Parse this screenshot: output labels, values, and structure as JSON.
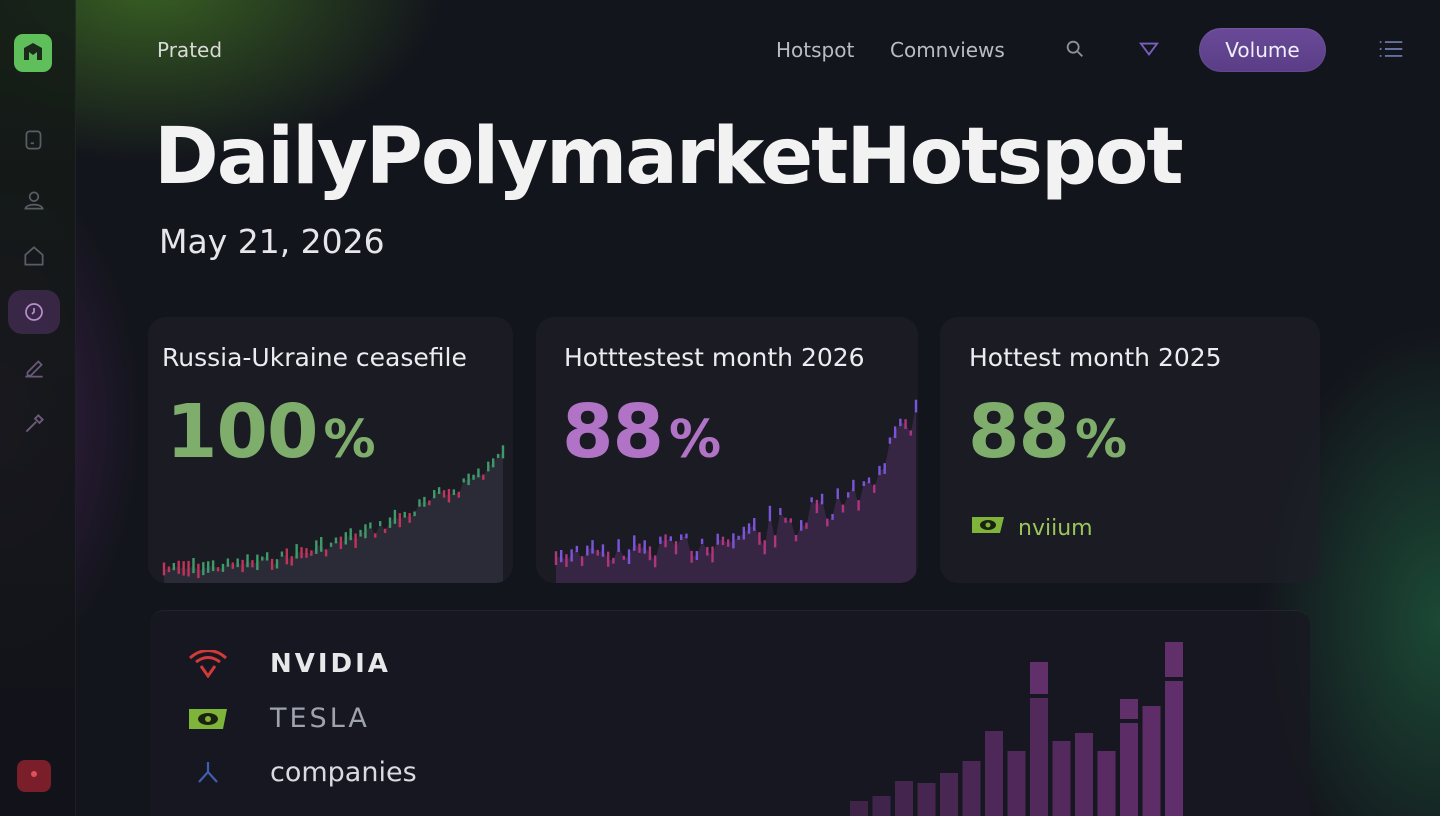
{
  "header": {
    "brand": "Prated",
    "nav": [
      "Hotspot",
      "Comnviews"
    ],
    "volume_label": "Volume"
  },
  "page": {
    "title": "DailyPolymarketHotspot",
    "date": "May 21, 2026"
  },
  "cards": [
    {
      "title": "Russia-Ukraine ceasefile",
      "value": "100",
      "unit": "%",
      "color": "#7fae6c"
    },
    {
      "title": "Hotttestest month 2026",
      "value": "88",
      "unit": "%",
      "color": "#b073c6"
    },
    {
      "title": "Hottest month 2025",
      "value": "88",
      "unit": "%",
      "color": "#7fae6c",
      "tag": "nviium"
    }
  ],
  "list": [
    {
      "label": "NVIDIA",
      "icon": "red-shield-icon"
    },
    {
      "label": "TESLA",
      "icon": "nvidia-eye-icon"
    },
    {
      "label": "companies",
      "icon": "branch-icon"
    }
  ],
  "colors": {
    "accent_purple": "#6a4a98",
    "accent_green": "#5fbf5a"
  }
}
